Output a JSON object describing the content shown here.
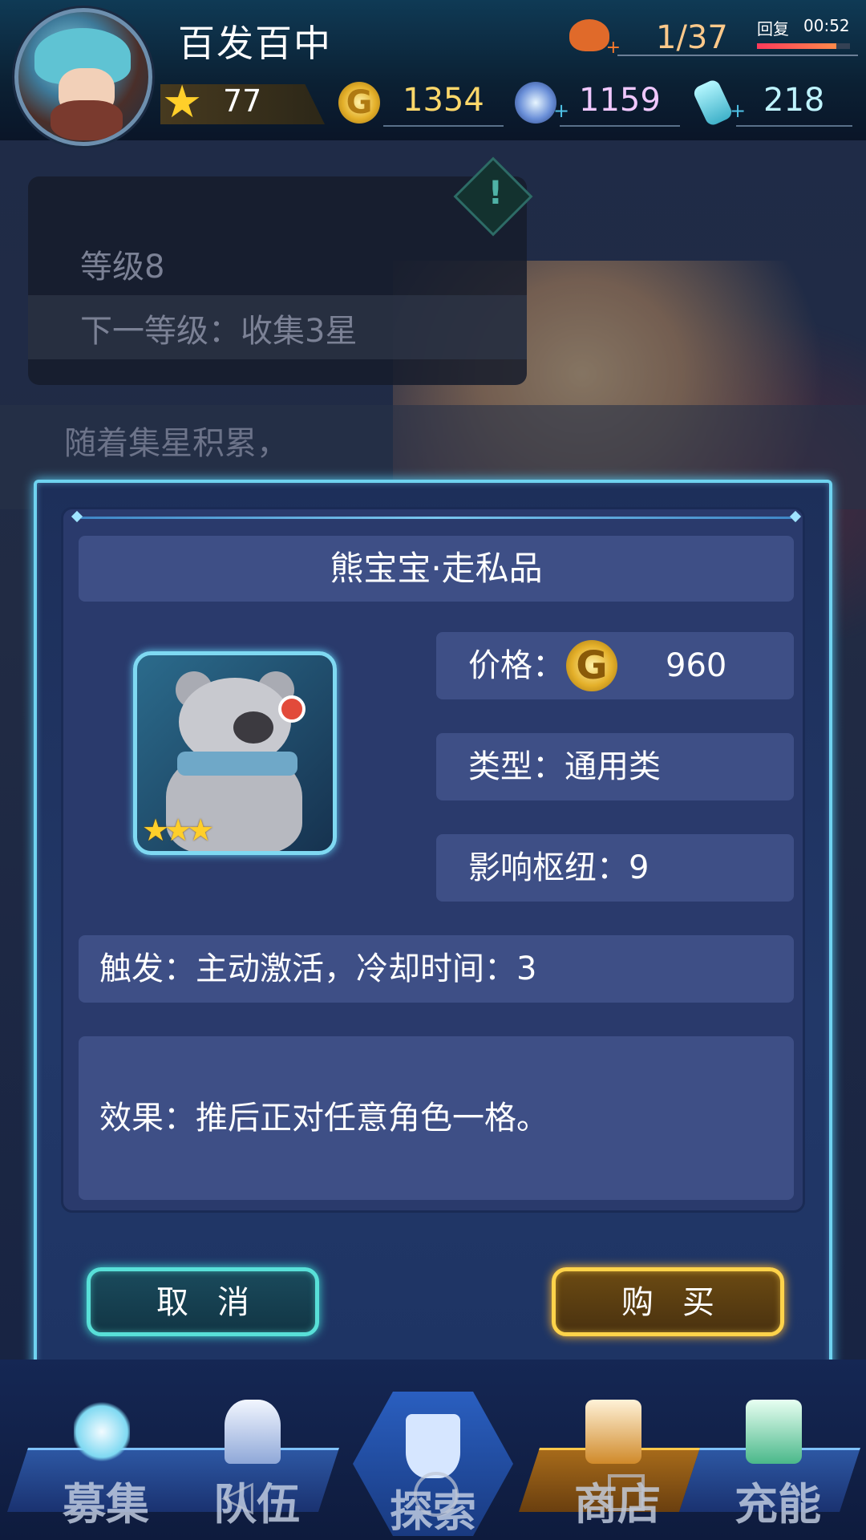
{
  "hud": {
    "player_name": "百发百中",
    "stamina": "1/37",
    "recover_label": "回复",
    "recover_time": "00:52",
    "stamina_fill": 0.85,
    "stars": "77",
    "gold": "1354",
    "gems": "1159",
    "potions": "218",
    "icons": [
      "stamina-icon",
      "star-icon",
      "gold-coin-icon",
      "gem-icon",
      "potion-icon"
    ]
  },
  "background": {
    "level_title": "等级8",
    "level_next": "下一等级：收集3星",
    "description": "随着集星积累，"
  },
  "modal": {
    "item_name": "熊宝宝·走私品",
    "price_label": "价格：",
    "price_value": "960",
    "type_text": "类型：通用类",
    "hub_text": "影响枢纽：9",
    "trigger_text": "触发：主动激活，冷却时间：3",
    "effect_text": "效果：推后正对任意角色一格。",
    "item_stars": 3,
    "cancel_label": "取消",
    "buy_label": "购买"
  },
  "nav": {
    "recruit": "募集",
    "team": "队伍",
    "explore": "探索",
    "shop": "商店",
    "charge": "充能"
  },
  "colors": {
    "modal_border": "#6fd3f0",
    "cancel_border": "#58e0d8",
    "buy_border": "#ffd34a",
    "gold_text": "#ffd86a",
    "gem_text": "#f0c8ff",
    "potion_text": "#bff4ff"
  }
}
